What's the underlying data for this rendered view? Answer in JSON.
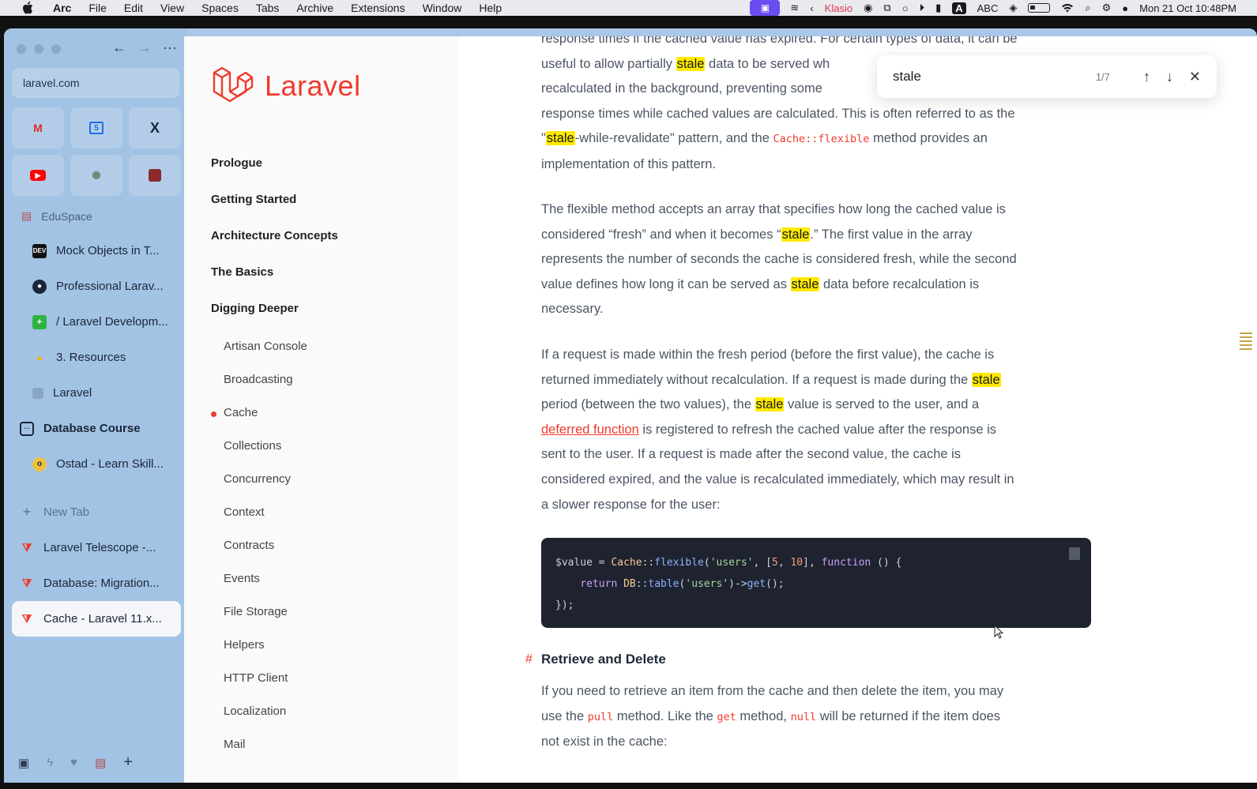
{
  "menubar": {
    "app": "Arc",
    "items": [
      "File",
      "Edit",
      "View",
      "Spaces",
      "Tabs",
      "Archive",
      "Extensions",
      "Window",
      "Help"
    ],
    "status": {
      "klasio": "Klasio",
      "abc": "ABC",
      "datetime": "Mon 21 Oct  10:48PM"
    }
  },
  "sidebar": {
    "url": "laravel.com",
    "space_title": "EduSpace",
    "tabs": [
      {
        "label": "Mock Objects in T...",
        "icon": "dev-icon"
      },
      {
        "label": "Professional Larav...",
        "icon": "github-icon"
      },
      {
        "label": "/ Laravel Developm...",
        "icon": "plus-square-icon"
      },
      {
        "label": "3. Resources",
        "icon": "google-drive-icon"
      },
      {
        "label": "Laravel",
        "icon": "page-icon"
      }
    ],
    "folder": "Database Course",
    "folder_tabs": [
      {
        "label": "Ostad - Learn Skill...",
        "icon": "ostad-icon"
      }
    ],
    "new_tab": "New Tab",
    "pinned_tabs": [
      {
        "label": "Laravel Telescope -...",
        "icon": "laravel-icon"
      },
      {
        "label": "Database: Migration...",
        "icon": "laravel-icon"
      },
      {
        "label": "Cache - Laravel 11.x...",
        "icon": "laravel-icon",
        "active": true
      }
    ]
  },
  "docs_nav": {
    "logo_text": "Laravel",
    "sections": [
      "Prologue",
      "Getting Started",
      "Architecture Concepts",
      "The Basics",
      "Digging Deeper"
    ],
    "subitems": [
      "Artisan Console",
      "Broadcasting",
      "Cache",
      "Collections",
      "Concurrency",
      "Context",
      "Contracts",
      "Events",
      "File Storage",
      "Helpers",
      "HTTP Client",
      "Localization",
      "Mail"
    ],
    "current": "Cache"
  },
  "find": {
    "query": "stale",
    "count": "1/7"
  },
  "content": {
    "p0_line1": "response times if the cached value has expired. For certain types of data, it can be",
    "p0_line2a": "useful to allow partially ",
    "p0_line2b": " data to be served wh",
    "p0_line3": "recalculated in the background, preventing some",
    "p0_line4": "response times while cached values are calculated. This is often referred to as the",
    "p0_line5a": "\"",
    "p0_line5b": "-while-revalidate\" pattern, and the ",
    "p0_code": "Cache::flexible",
    "p0_line5c": " method provides an",
    "p0_line6": "implementation of this pattern.",
    "hl_word": "stale",
    "p1_line1": "The flexible method accepts an array that specifies how long the cached value is",
    "p1_line2a": "considered “fresh” and when it becomes “",
    "p1_line2b": ".” The first value in the array",
    "p1_line3": "represents the number of seconds the cache is considered fresh, while the second",
    "p1_line4a": "value defines how long it can be served as ",
    "p1_line4b": " data before recalculation is",
    "p1_line5": "necessary.",
    "p2_line1": "If a request is made within the fresh period (before the first value), the cache is",
    "p2_line2a": "returned immediately without recalculation. If a request is made during the ",
    "p2_line3a": "period (between the two values), the ",
    "p2_line3b": " value is served to the user, and a",
    "p2_link": "deferred function",
    "p2_line4b": " is registered to refresh the cached value after the response is",
    "p2_line5": "sent to the user. If a request is made after the second value, the cache is",
    "p2_line6": "considered expired, and the value is recalculated immediately, which may result in",
    "p2_line7": "a slower response for the user:",
    "code": {
      "l1_var": "$value",
      "l1_eq": " = ",
      "l1_class": "Cache",
      "l1_sep": "::",
      "l1_fn": "flexible",
      "l1_p1": "(",
      "l1_str": "'users'",
      "l1_p2": ", [",
      "l1_n1": "5",
      "l1_p3": ", ",
      "l1_n2": "10",
      "l1_p4": "], ",
      "l1_kw": "function",
      "l1_p5": " () {",
      "l2_kw": "    return ",
      "l2_class": "DB",
      "l2_sep": "::",
      "l2_fn": "table",
      "l2_p1": "(",
      "l2_str": "'users'",
      "l2_p2": ")->",
      "l2_fn2": "get",
      "l2_p3": "();",
      "l3": "});"
    },
    "heading_hash": "#",
    "heading": "Retrieve and Delete",
    "p3_line1": "If you need to retrieve an item from the cache and then delete the item, you may",
    "p3_line2a": "use the ",
    "p3_code1": "pull",
    "p3_line2b": " method. Like the ",
    "p3_code2": "get",
    "p3_line2c": " method, ",
    "p3_code3": "null",
    "p3_line2d": " will be returned if the item does",
    "p3_line3": "not exist in the cache:"
  },
  "colors": {
    "accent": "#ef3b2d",
    "highlight": "#ffea00",
    "sidebar_bg": "#a3c3e5",
    "code_bg": "#1f2330"
  }
}
